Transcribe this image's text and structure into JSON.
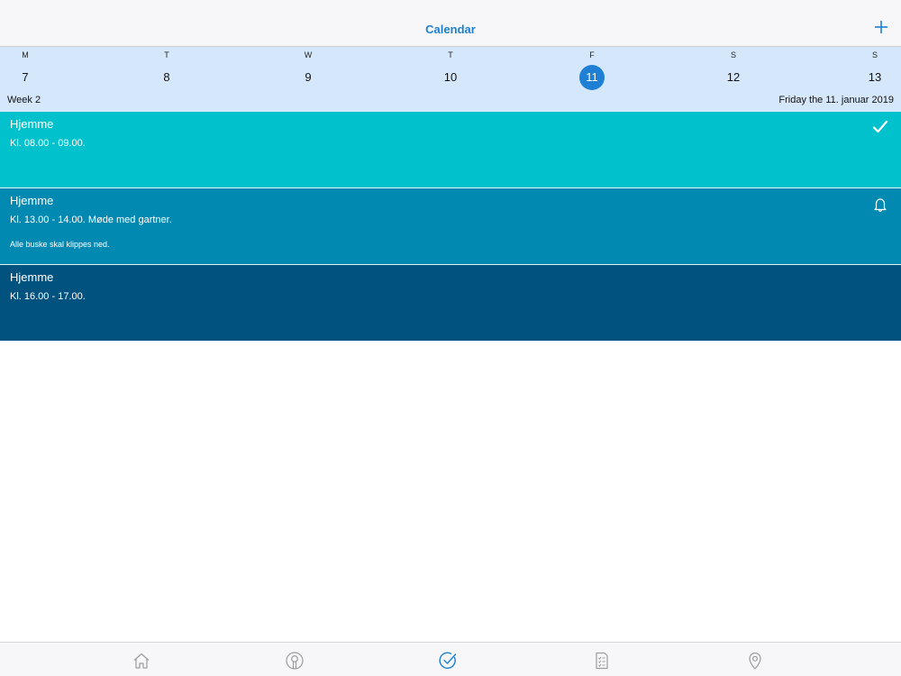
{
  "navbar": {
    "title": "Calendar",
    "add_icon": "plus-icon"
  },
  "week": {
    "label": "Week 2",
    "selected_date_text": "Friday the 11. januar 2019",
    "days": [
      {
        "letter": "M",
        "number": "7",
        "selected": false
      },
      {
        "letter": "T",
        "number": "8",
        "selected": false
      },
      {
        "letter": "W",
        "number": "9",
        "selected": false
      },
      {
        "letter": "T",
        "number": "10",
        "selected": false
      },
      {
        "letter": "F",
        "number": "11",
        "selected": true
      },
      {
        "letter": "S",
        "number": "12",
        "selected": false
      },
      {
        "letter": "S",
        "number": "13",
        "selected": false
      }
    ],
    "selected_color": "#1f7fd4",
    "strip_color": "#d5e7fa"
  },
  "events": [
    {
      "title": "Hjemme",
      "time": "Kl. 08.00 - 09.00.",
      "note": "",
      "icon": "checkmark-icon",
      "color": "#00c1cc"
    },
    {
      "title": "Hjemme",
      "time": "Kl. 13.00 - 14.00. Møde med gartner.",
      "note": "Alle buske skal klippes ned.",
      "icon": "bell-icon",
      "color": "#0189b2"
    },
    {
      "title": "Hjemme",
      "time": "Kl. 16.00 - 17.00.",
      "note": "",
      "icon": "",
      "color": "#01527f"
    }
  ],
  "tabbar": {
    "tabs": [
      {
        "icon": "home-icon",
        "active": false
      },
      {
        "icon": "profile-icon",
        "active": false
      },
      {
        "icon": "calendar-check-icon",
        "active": true
      },
      {
        "icon": "checklist-icon",
        "active": false
      },
      {
        "icon": "location-pin-icon",
        "active": false
      }
    ],
    "active_color": "#1d7fd0",
    "inactive_color": "#9b9ba0"
  }
}
